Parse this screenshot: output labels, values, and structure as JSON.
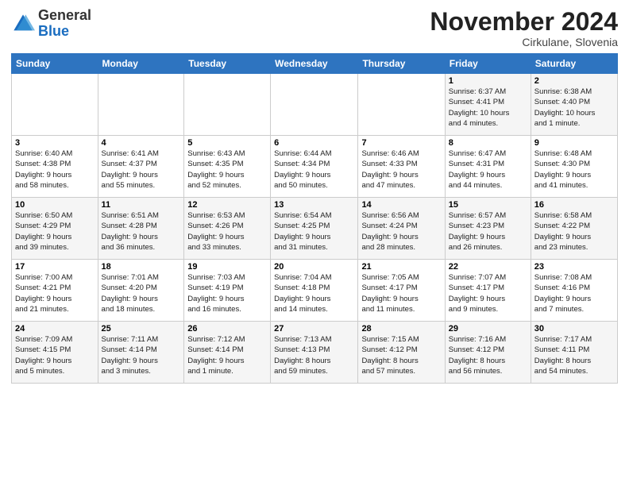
{
  "logo": {
    "general": "General",
    "blue": "Blue"
  },
  "header": {
    "month": "November 2024",
    "location": "Cirkulane, Slovenia"
  },
  "days_of_week": [
    "Sunday",
    "Monday",
    "Tuesday",
    "Wednesday",
    "Thursday",
    "Friday",
    "Saturday"
  ],
  "weeks": [
    [
      {
        "day": "",
        "info": ""
      },
      {
        "day": "",
        "info": ""
      },
      {
        "day": "",
        "info": ""
      },
      {
        "day": "",
        "info": ""
      },
      {
        "day": "",
        "info": ""
      },
      {
        "day": "1",
        "info": "Sunrise: 6:37 AM\nSunset: 4:41 PM\nDaylight: 10 hours\nand 4 minutes."
      },
      {
        "day": "2",
        "info": "Sunrise: 6:38 AM\nSunset: 4:40 PM\nDaylight: 10 hours\nand 1 minute."
      }
    ],
    [
      {
        "day": "3",
        "info": "Sunrise: 6:40 AM\nSunset: 4:38 PM\nDaylight: 9 hours\nand 58 minutes."
      },
      {
        "day": "4",
        "info": "Sunrise: 6:41 AM\nSunset: 4:37 PM\nDaylight: 9 hours\nand 55 minutes."
      },
      {
        "day": "5",
        "info": "Sunrise: 6:43 AM\nSunset: 4:35 PM\nDaylight: 9 hours\nand 52 minutes."
      },
      {
        "day": "6",
        "info": "Sunrise: 6:44 AM\nSunset: 4:34 PM\nDaylight: 9 hours\nand 50 minutes."
      },
      {
        "day": "7",
        "info": "Sunrise: 6:46 AM\nSunset: 4:33 PM\nDaylight: 9 hours\nand 47 minutes."
      },
      {
        "day": "8",
        "info": "Sunrise: 6:47 AM\nSunset: 4:31 PM\nDaylight: 9 hours\nand 44 minutes."
      },
      {
        "day": "9",
        "info": "Sunrise: 6:48 AM\nSunset: 4:30 PM\nDaylight: 9 hours\nand 41 minutes."
      }
    ],
    [
      {
        "day": "10",
        "info": "Sunrise: 6:50 AM\nSunset: 4:29 PM\nDaylight: 9 hours\nand 39 minutes."
      },
      {
        "day": "11",
        "info": "Sunrise: 6:51 AM\nSunset: 4:28 PM\nDaylight: 9 hours\nand 36 minutes."
      },
      {
        "day": "12",
        "info": "Sunrise: 6:53 AM\nSunset: 4:26 PM\nDaylight: 9 hours\nand 33 minutes."
      },
      {
        "day": "13",
        "info": "Sunrise: 6:54 AM\nSunset: 4:25 PM\nDaylight: 9 hours\nand 31 minutes."
      },
      {
        "day": "14",
        "info": "Sunrise: 6:56 AM\nSunset: 4:24 PM\nDaylight: 9 hours\nand 28 minutes."
      },
      {
        "day": "15",
        "info": "Sunrise: 6:57 AM\nSunset: 4:23 PM\nDaylight: 9 hours\nand 26 minutes."
      },
      {
        "day": "16",
        "info": "Sunrise: 6:58 AM\nSunset: 4:22 PM\nDaylight: 9 hours\nand 23 minutes."
      }
    ],
    [
      {
        "day": "17",
        "info": "Sunrise: 7:00 AM\nSunset: 4:21 PM\nDaylight: 9 hours\nand 21 minutes."
      },
      {
        "day": "18",
        "info": "Sunrise: 7:01 AM\nSunset: 4:20 PM\nDaylight: 9 hours\nand 18 minutes."
      },
      {
        "day": "19",
        "info": "Sunrise: 7:03 AM\nSunset: 4:19 PM\nDaylight: 9 hours\nand 16 minutes."
      },
      {
        "day": "20",
        "info": "Sunrise: 7:04 AM\nSunset: 4:18 PM\nDaylight: 9 hours\nand 14 minutes."
      },
      {
        "day": "21",
        "info": "Sunrise: 7:05 AM\nSunset: 4:17 PM\nDaylight: 9 hours\nand 11 minutes."
      },
      {
        "day": "22",
        "info": "Sunrise: 7:07 AM\nSunset: 4:17 PM\nDaylight: 9 hours\nand 9 minutes."
      },
      {
        "day": "23",
        "info": "Sunrise: 7:08 AM\nSunset: 4:16 PM\nDaylight: 9 hours\nand 7 minutes."
      }
    ],
    [
      {
        "day": "24",
        "info": "Sunrise: 7:09 AM\nSunset: 4:15 PM\nDaylight: 9 hours\nand 5 minutes."
      },
      {
        "day": "25",
        "info": "Sunrise: 7:11 AM\nSunset: 4:14 PM\nDaylight: 9 hours\nand 3 minutes."
      },
      {
        "day": "26",
        "info": "Sunrise: 7:12 AM\nSunset: 4:14 PM\nDaylight: 9 hours\nand 1 minute."
      },
      {
        "day": "27",
        "info": "Sunrise: 7:13 AM\nSunset: 4:13 PM\nDaylight: 8 hours\nand 59 minutes."
      },
      {
        "day": "28",
        "info": "Sunrise: 7:15 AM\nSunset: 4:12 PM\nDaylight: 8 hours\nand 57 minutes."
      },
      {
        "day": "29",
        "info": "Sunrise: 7:16 AM\nSunset: 4:12 PM\nDaylight: 8 hours\nand 56 minutes."
      },
      {
        "day": "30",
        "info": "Sunrise: 7:17 AM\nSunset: 4:11 PM\nDaylight: 8 hours\nand 54 minutes."
      }
    ]
  ]
}
